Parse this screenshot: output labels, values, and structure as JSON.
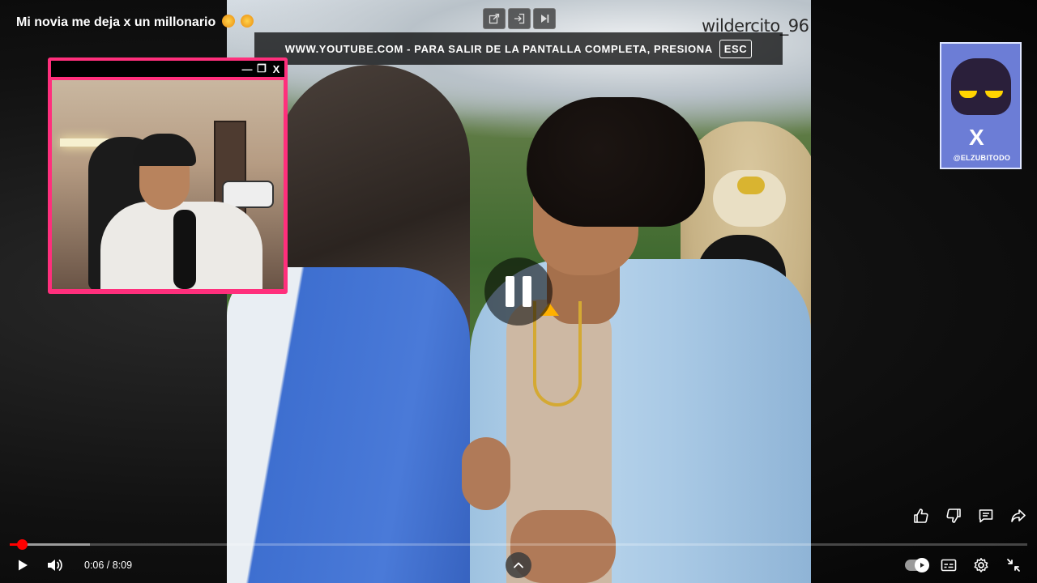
{
  "video": {
    "title": "Mi novia me deja x un millonario",
    "title_emojis": [
      "crying-face-emoji",
      "crying-face-emoji"
    ],
    "watermark": "wildercito_96"
  },
  "fullscreen_banner": {
    "message": "WWW.YOUTUBE.COM - PARA SALIR DE LA PANTALLA COMPLETA, PRESIONA",
    "key_label": "ESC"
  },
  "player_overlay": {
    "state_icon": "pause-icon"
  },
  "top_tools": {
    "icons": [
      "popout-icon",
      "enter-icon",
      "skip-icon"
    ]
  },
  "pip_window": {
    "border_color": "#ff2f7c",
    "buttons": {
      "minimize": "—",
      "restore": "❐",
      "close": "X"
    }
  },
  "social_card": {
    "logo": "X",
    "handle": "@ELZUBITODO"
  },
  "side_actions": {
    "icons": [
      "like-icon",
      "dislike-icon",
      "comment-icon",
      "share-icon"
    ]
  },
  "progress": {
    "played_fraction": 0.012,
    "buffered_fraction": 0.079,
    "color": "#ff0000"
  },
  "controls": {
    "current_time": "0:06",
    "duration": "8:09",
    "time_text": "0:06 / 8:09",
    "autoplay_on": true
  }
}
